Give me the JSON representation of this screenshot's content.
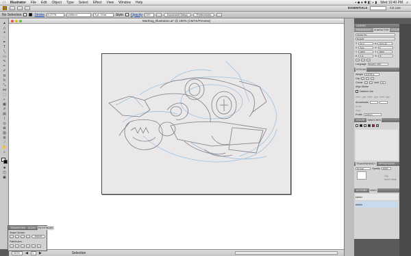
{
  "menubar": {
    "app": "Illustrator",
    "items": [
      "File",
      "Edit",
      "Object",
      "Type",
      "Select",
      "Effect",
      "View",
      "Window",
      "Help"
    ],
    "clock": "Wed 10:40 PM"
  },
  "appbar": {
    "workspace": "ESSENTIALS",
    "cs_live": "CS Live"
  },
  "control": {
    "selection": "No Selection",
    "stroke_label": "Stroke",
    "stroke_weight": "0.3778",
    "brush": "Uniform",
    "pt_value": "3 pt. Oval",
    "style_label": "Style",
    "opacity_label": "Opacity",
    "opacity": "100",
    "doc_setup": "Document Setup",
    "preferences": "Preferences"
  },
  "document": {
    "tab_title": "Warthog_Illustration.ai* @ 150% (CMYK/Preview)"
  },
  "status": {
    "zoom": "150%",
    "page": "1",
    "mode": "Selection"
  },
  "panels": {
    "top_tabs": [
      "LAYERS",
      "PARA",
      "CHARACTER",
      "COLOR"
    ],
    "char_tabs": [
      "PARAGRAPH",
      "CHARACTER",
      "COLOR"
    ],
    "font_family": "Myriad Pro",
    "font_style": "Regular",
    "font_size": "12 pt",
    "leading": "(14.4 pt)",
    "tracking": "Auto",
    "kerning": "0",
    "scale_h": "100%",
    "scale_v": "100%",
    "baseline": "0 pt",
    "rotate": "0°",
    "language_label": "Language",
    "language": "English: USA",
    "stroke_tab": "STROKE",
    "weight_label": "Weight",
    "weight": "0.3778 pt",
    "cap_label": "Cap",
    "corner_label": "Corner",
    "limit_label": "Limit",
    "limit": "10",
    "align_label": "Align Stroke",
    "dashed_label": "Dashed Line",
    "dash_labels": [
      "dash",
      "gap",
      "dash",
      "gap",
      "dash",
      "gap"
    ],
    "arrowheads_label": "Arrowheads",
    "scale_label": "Scale",
    "align_label2": "Align",
    "profile_label": "Profile",
    "profile": "Uniform",
    "color_tabs": [
      "COLOR",
      "SWATCHES"
    ],
    "transparency_tabs": [
      "TRANSPARENCY",
      "APPEARANCE"
    ],
    "blend_mode": "Normal",
    "opacity_label": "Opacity",
    "opacity": "100%",
    "clip_label": "Clip",
    "invert_label": "Invert Mask",
    "actions_tabs": [
      "ACTIONS",
      "LINKS"
    ],
    "links": [
      "sketch",
      "sketch"
    ]
  },
  "pathfinder": {
    "tabs": [
      "TRANSFORM",
      "ALIGN",
      "PATHFINDER"
    ],
    "shape_modes": "Shape Modes:",
    "expand": "Expand",
    "pathfinders": "Pathfinders:"
  },
  "colors": {
    "sketch_blue": "#8fbde0",
    "sketch_gray": "#7a7a80",
    "artboard": "#ebe8ea"
  }
}
